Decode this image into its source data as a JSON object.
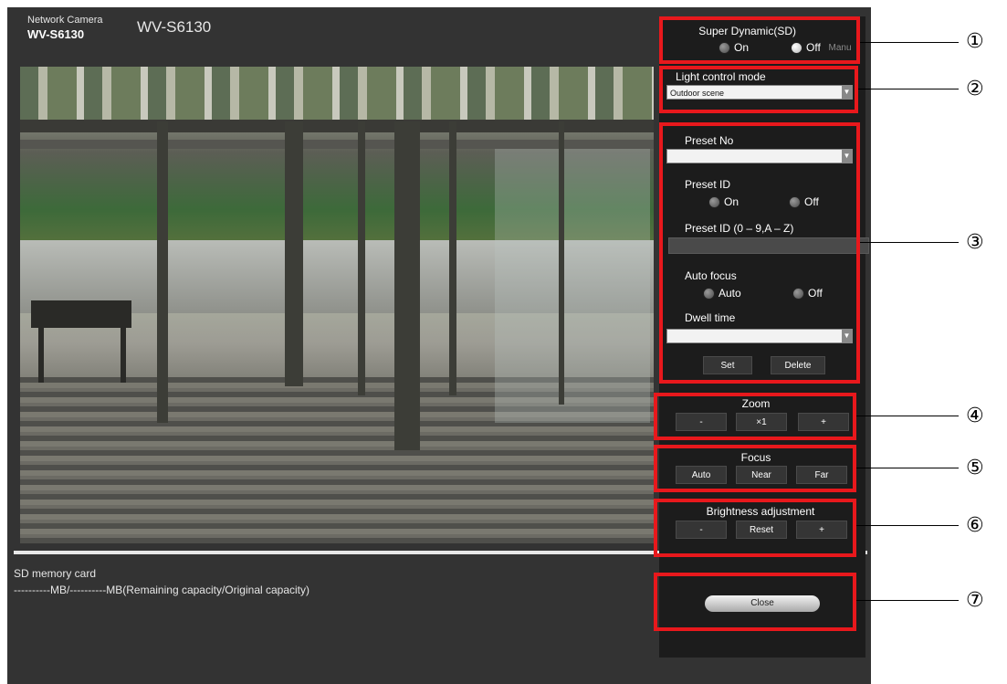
{
  "header": {
    "brand": "Network Camera",
    "model": "WV-S6130",
    "camera_title": "WV-S6130"
  },
  "sd_card": {
    "label": "SD memory card",
    "capacity": "----------MB/----------MB(Remaining capacity/Original capacity)"
  },
  "panel": {
    "super_dynamic": {
      "label": "Super Dynamic(SD)",
      "on": "On",
      "off": "Off",
      "selected": "Off",
      "trailing": "Manu"
    },
    "light_control": {
      "label": "Light control mode",
      "value": "Outdoor scene"
    },
    "preset": {
      "no_label": "Preset No",
      "no_value": "",
      "id_label": "Preset ID",
      "id_on": "On",
      "id_off": "Off",
      "id_field_label": "Preset ID (0 – 9,A – Z)",
      "id_field_value": "",
      "auto_focus_label": "Auto focus",
      "af_auto": "Auto",
      "af_off": "Off",
      "dwell_label": "Dwell time",
      "dwell_value": "",
      "set": "Set",
      "delete": "Delete"
    },
    "zoom": {
      "label": "Zoom",
      "minus": "-",
      "x1": "×1",
      "plus": "+"
    },
    "focus": {
      "label": "Focus",
      "auto": "Auto",
      "near": "Near",
      "far": "Far"
    },
    "brightness": {
      "label": "Brightness adjustment",
      "minus": "-",
      "reset": "Reset",
      "plus": "+"
    },
    "close": "Close"
  },
  "callouts": [
    "①",
    "②",
    "③",
    "④",
    "⑤",
    "⑥",
    "⑦"
  ],
  "colors": {
    "highlight": "#e8181c",
    "panel_bg": "#1c1c1c",
    "screen_bg": "#333333"
  }
}
